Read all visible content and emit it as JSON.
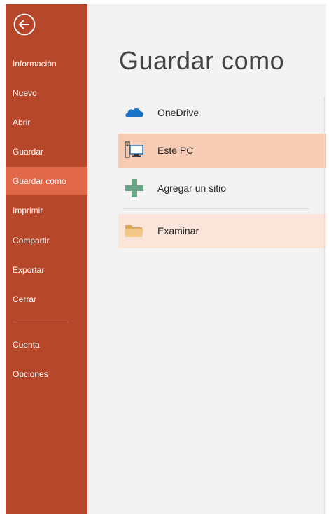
{
  "sidebar": {
    "items": [
      {
        "label": "Información"
      },
      {
        "label": "Nuevo"
      },
      {
        "label": "Abrir"
      },
      {
        "label": "Guardar"
      },
      {
        "label": "Guardar como"
      },
      {
        "label": "Imprimir"
      },
      {
        "label": "Compartir"
      },
      {
        "label": "Exportar"
      },
      {
        "label": "Cerrar"
      },
      {
        "label": "Cuenta"
      },
      {
        "label": "Opciones"
      }
    ],
    "active_item": "Guardar como"
  },
  "main": {
    "title": "Guardar como",
    "locations": [
      {
        "label": "OneDrive",
        "icon": "onedrive-cloud-icon"
      },
      {
        "label": "Este PC",
        "icon": "computer-icon",
        "selected": true
      },
      {
        "label": "Agregar un sitio",
        "icon": "plus-icon"
      },
      {
        "label": "Examinar",
        "icon": "folder-icon"
      }
    ]
  },
  "colors": {
    "sidebar_bg": "#b7472a",
    "sidebar_active": "#e2684a",
    "selected_bg": "#f8ccb4",
    "hover_bg": "#fbe4d9",
    "onedrive_blue": "#1a73c7",
    "plus_green": "#6aa58a",
    "folder_tan": "#f0c787"
  }
}
